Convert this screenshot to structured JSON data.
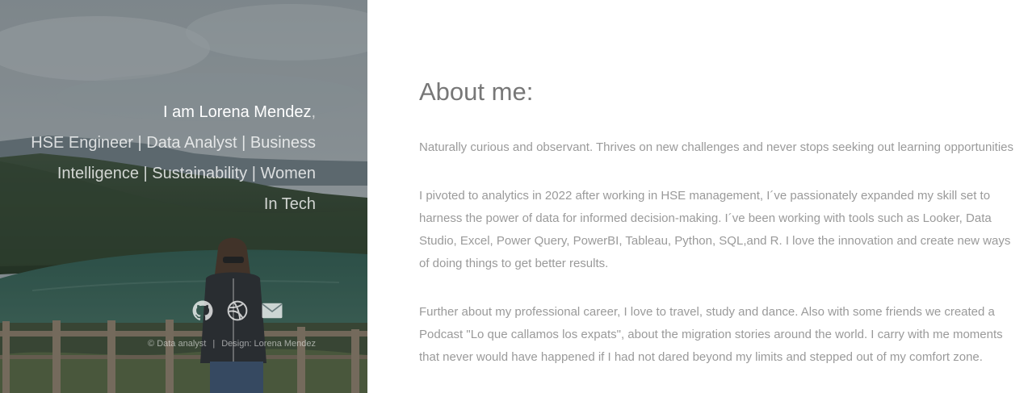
{
  "hero": {
    "intro_name": "I am Lorena Mendez",
    "intro_comma": ",",
    "intro_line_1": "HSE Engineer | Data Analyst | Business",
    "intro_line_2": "Intelligence | Sustainability | Women",
    "intro_line_3": "In Tech",
    "social": [
      {
        "icon": "github-icon"
      },
      {
        "icon": "dribbble-icon"
      },
      {
        "icon": "mail-icon"
      }
    ],
    "footer_left": "© Data analyst",
    "footer_sep": "|",
    "footer_right": "Design: Lorena Mendez"
  },
  "about": {
    "title": "About me:",
    "paragraphs": [
      "Naturally curious and observant. Thrives on new challenges and never stops seeking out learning opportunities",
      "I pivoted to analytics in 2022 after working in HSE management, I´ve passionately expanded my skill set to harness the power of data for informed decision-making. I´ve been working with tools such as Looker, Data Studio, Excel, Power Query, PowerBI, Tableau, Python, SQL,and R. I love the innovation and create new ways of doing things to get better results.",
      "Further about my professional career, I love to travel, study and dance. Also with some friends we created a Podcast \"Lo que callamos los expats\", about the migration stories around the world. I carry with me moments that never would have happened if I had not dared beyond my limits and stepped out of my comfort zone."
    ]
  },
  "colors": {
    "heading": "#777777",
    "body_text": "#9a9a9a",
    "hero_text": "#ffffff"
  }
}
